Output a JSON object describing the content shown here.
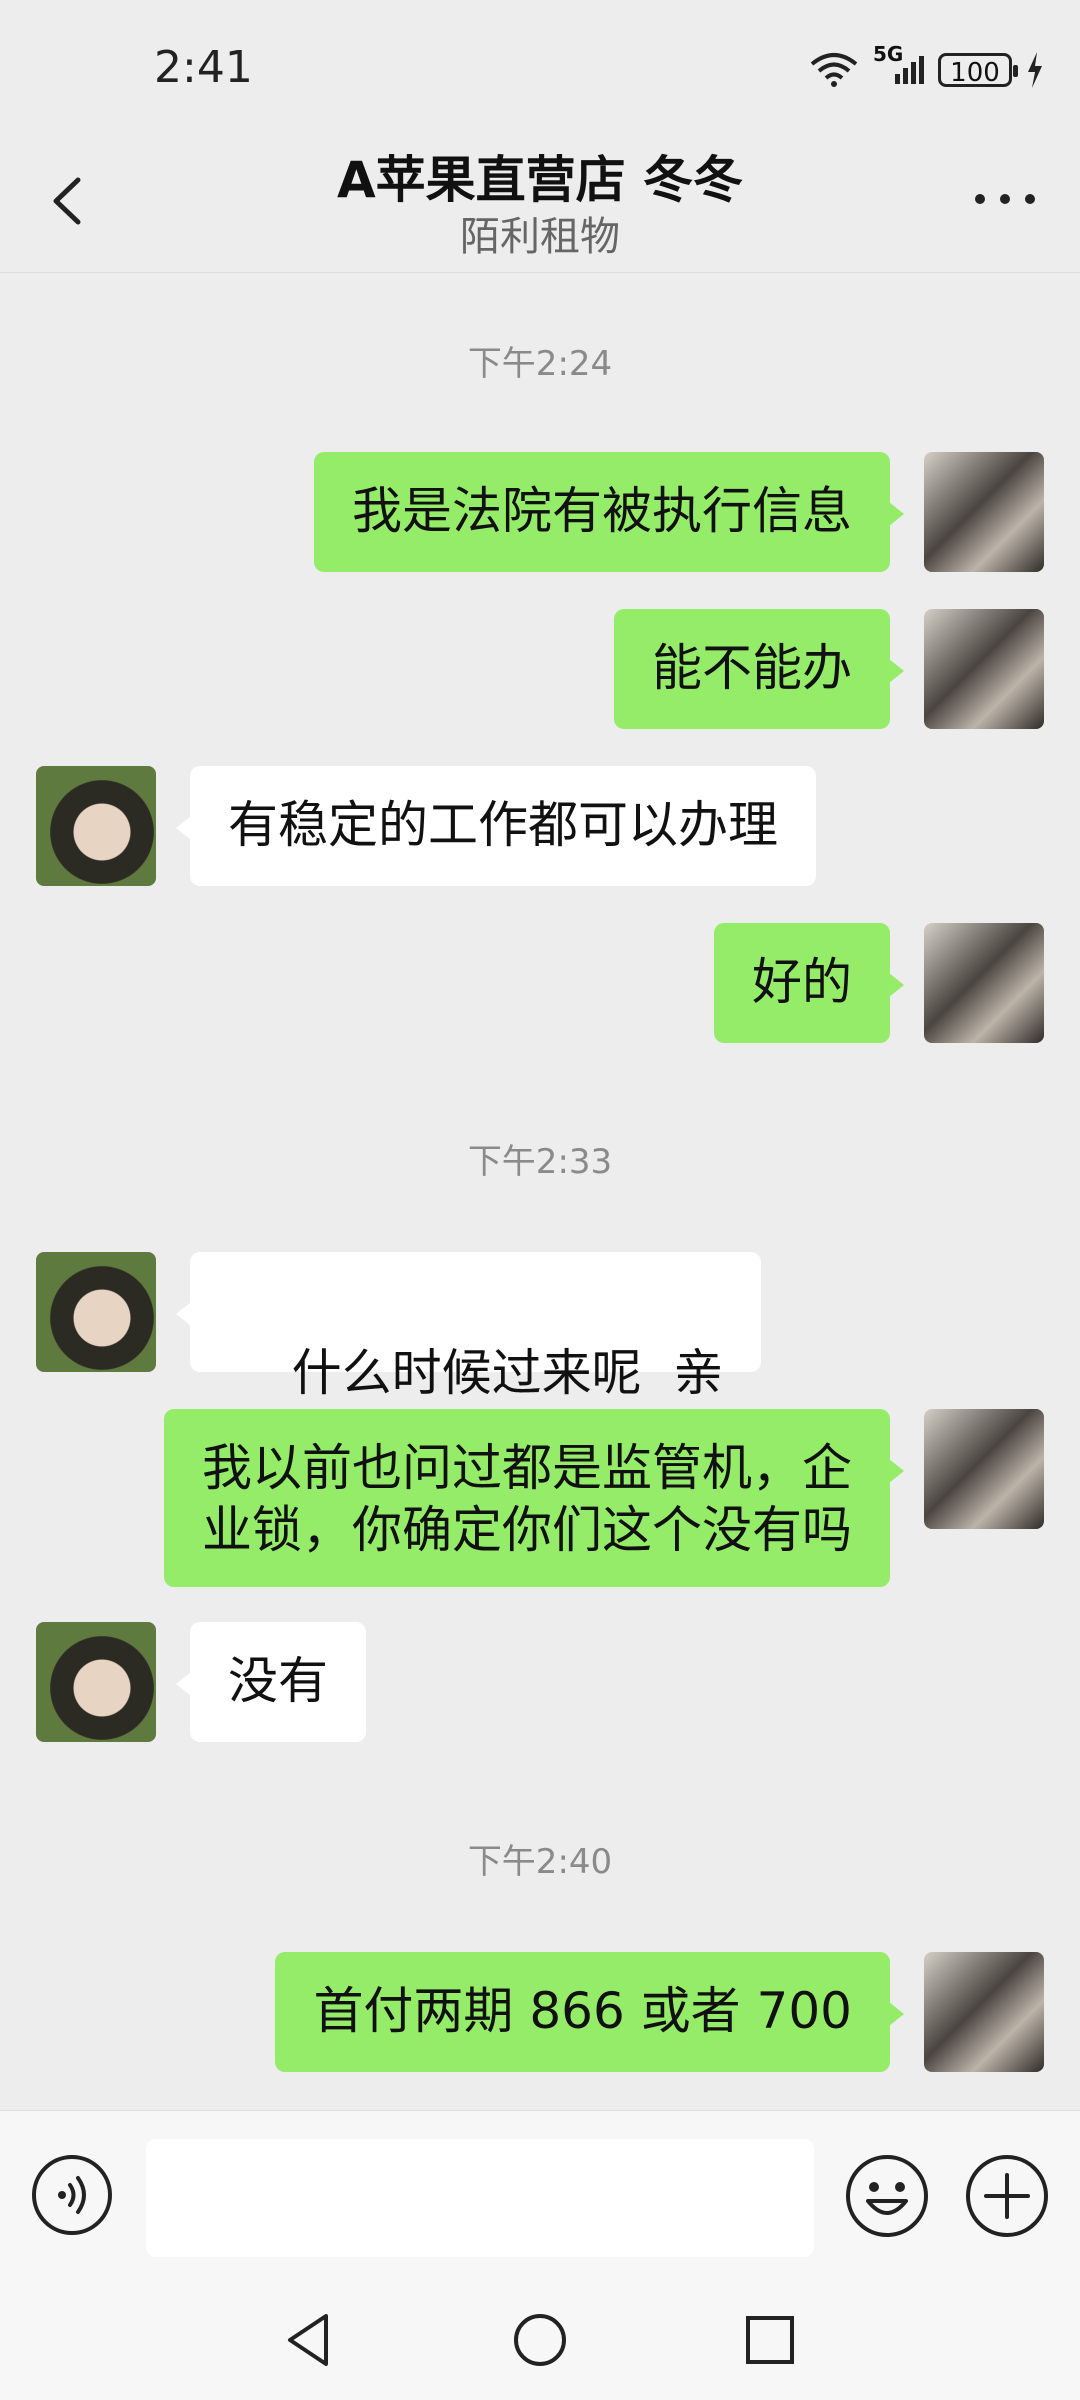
{
  "status_bar": {
    "time": "2:41",
    "network": "5G",
    "battery": "100"
  },
  "header": {
    "title": "A苹果直营店 冬冬",
    "subtitle": "陌利租物"
  },
  "messages": [
    {
      "type": "timestamp",
      "text": "下午2:24"
    },
    {
      "type": "sent",
      "text": "我是法院有被执行信息"
    },
    {
      "type": "sent",
      "text": "能不能办"
    },
    {
      "type": "received",
      "text": "有稳定的工作都可以办理"
    },
    {
      "type": "sent",
      "text": "好的"
    },
    {
      "type": "timestamp",
      "text": "下午2:33"
    },
    {
      "type": "received",
      "text": "什么时候过来呢  亲"
    },
    {
      "type": "sent",
      "text_line1": "我以前也问过都是监管机，企",
      "text_line2": "业锁，你确定你们这个没有吗"
    },
    {
      "type": "received",
      "text": "没有"
    },
    {
      "type": "timestamp",
      "text": "下午2:40"
    },
    {
      "type": "sent",
      "text": "首付两期 866 或者 700"
    }
  ],
  "input_bar": {
    "placeholder": "",
    "value": ""
  },
  "colors": {
    "sent_bubble": "#95ec69",
    "received_bubble": "#ffffff",
    "background": "#ededed"
  }
}
